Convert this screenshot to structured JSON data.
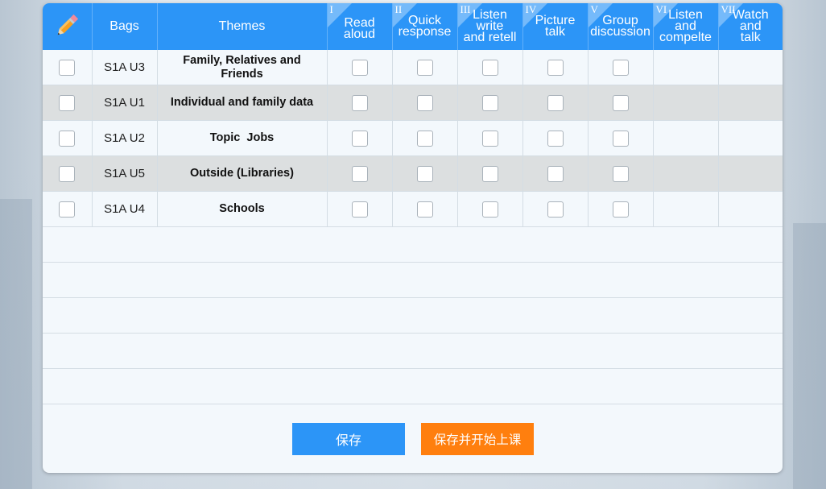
{
  "header": {
    "bags": "Bags",
    "themes": "Themes",
    "columns": [
      {
        "numeral": "I",
        "line1": "Read",
        "line2": "aloud",
        "line3": ""
      },
      {
        "numeral": "II",
        "line1": "Quick",
        "line2": "response",
        "line3": ""
      },
      {
        "numeral": "III",
        "line1": "Listen",
        "line2": "write",
        "line3": "and retell"
      },
      {
        "numeral": "IV",
        "line1": "Picture",
        "line2": "talk",
        "line3": ""
      },
      {
        "numeral": "V",
        "line1": "Group",
        "line2": "discussion",
        "line3": ""
      },
      {
        "numeral": "VI",
        "line1": "Listen",
        "line2": "and",
        "line3": "compelte"
      },
      {
        "numeral": "VII",
        "line1": "Watch",
        "line2": "and",
        "line3": "talk"
      }
    ]
  },
  "rows": [
    {
      "bag": "S1A U3",
      "theme_line1": "Family, Relatives and",
      "theme_line2": "Friends"
    },
    {
      "bag": "S1A U1",
      "theme_line1": "Individual and family data",
      "theme_line2": ""
    },
    {
      "bag": "S1A U2",
      "theme_line1": "Topic  Jobs",
      "theme_line2": ""
    },
    {
      "bag": "S1A U5",
      "theme_line1": "Outside (Libraries)",
      "theme_line2": ""
    },
    {
      "bag": "S1A U4",
      "theme_line1": "Schools",
      "theme_line2": ""
    }
  ],
  "buttons": {
    "save": "保存",
    "save_and_start": "保存并开始上课"
  },
  "colors": {
    "header_blue": "#2c95f7",
    "start_orange": "#ff7f0e",
    "alt_row_gray": "#dcdfe0"
  }
}
